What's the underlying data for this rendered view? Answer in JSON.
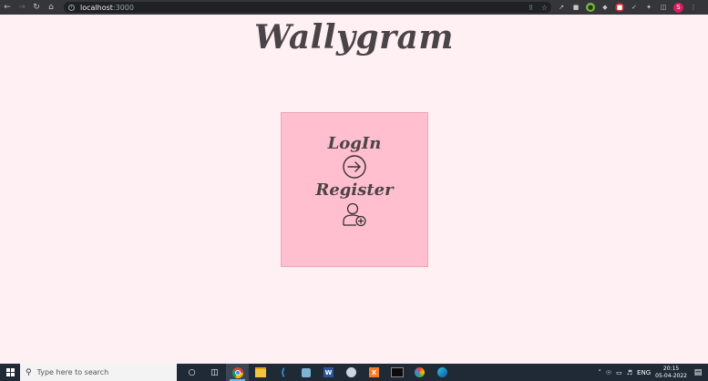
{
  "browser": {
    "url_host": "localhost",
    "url_port": ":3000",
    "profile_initial": "S"
  },
  "page": {
    "brand": "Wallygram",
    "login_label": "LogIn",
    "register_label": "Register"
  },
  "taskbar": {
    "search_placeholder": "Type here to search",
    "language": "ENG",
    "time": "20:15",
    "date": "05-04-2022"
  },
  "colors": {
    "page_background": "#fff0f3",
    "card_background": "#ffbfcf",
    "text": "#4a4347",
    "taskbar": "#1f2a36",
    "browser_bar": "#35363a"
  }
}
